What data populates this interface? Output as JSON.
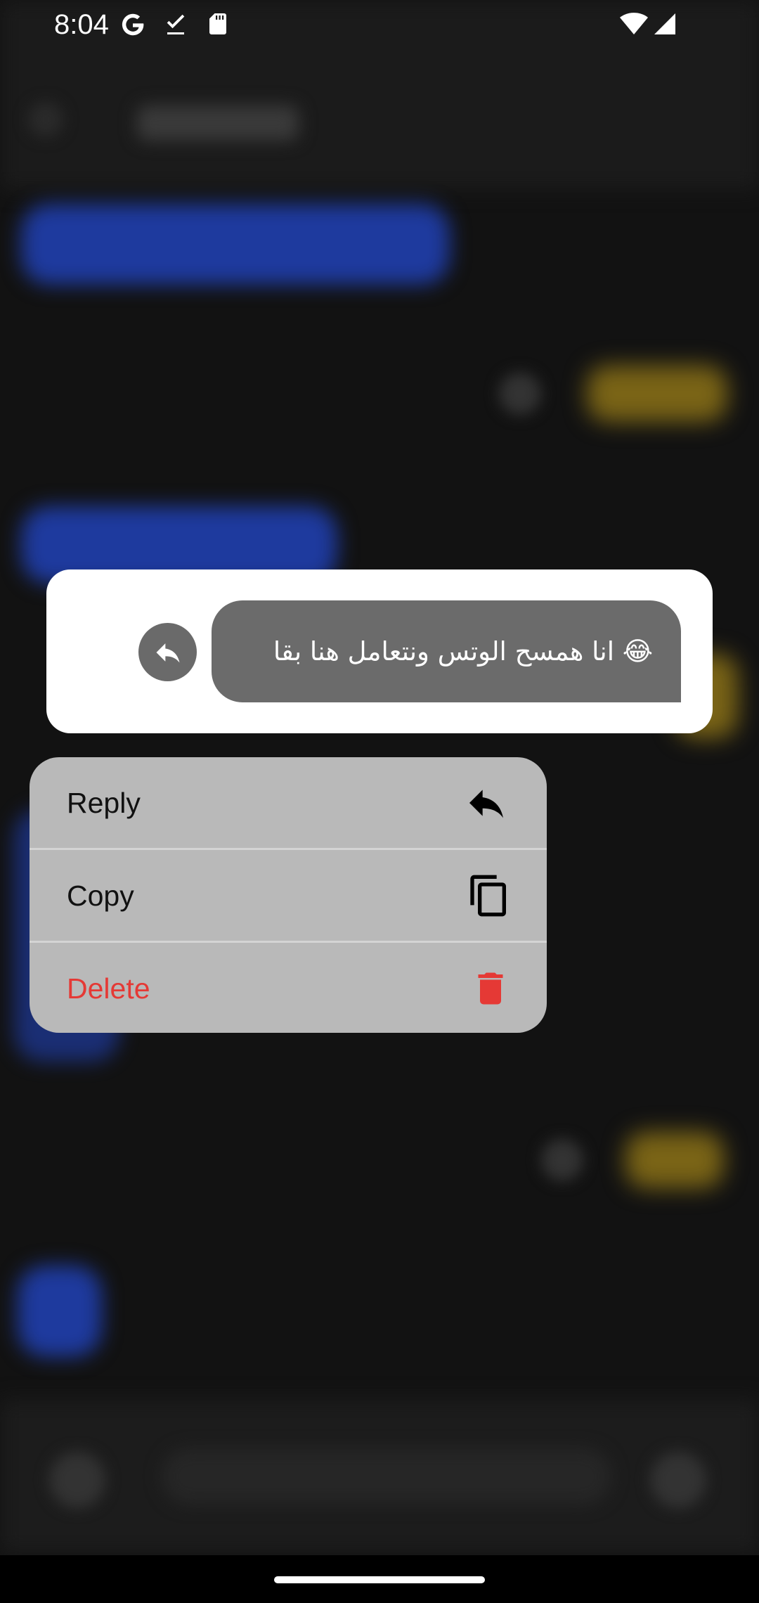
{
  "status_bar": {
    "time": "8:04",
    "icons": [
      "google-icon",
      "download-done-icon",
      "sd-card-icon",
      "wifi-icon",
      "signal-icon"
    ]
  },
  "message": {
    "text": "😂 انا همسح الوتس ونتعامل هنا بقا",
    "reply_icon": "reply-icon"
  },
  "context_menu": {
    "items": [
      {
        "label": "Reply",
        "icon": "reply-icon",
        "color": "#111111"
      },
      {
        "label": "Copy",
        "icon": "copy-icon",
        "color": "#111111"
      },
      {
        "label": "Delete",
        "icon": "trash-icon",
        "color": "#e53935"
      }
    ]
  },
  "colors": {
    "overlay_background": "#121212",
    "menu_background": "#b9b9b9",
    "bubble_background": "#6b6b6b",
    "delete_red": "#e53935"
  }
}
